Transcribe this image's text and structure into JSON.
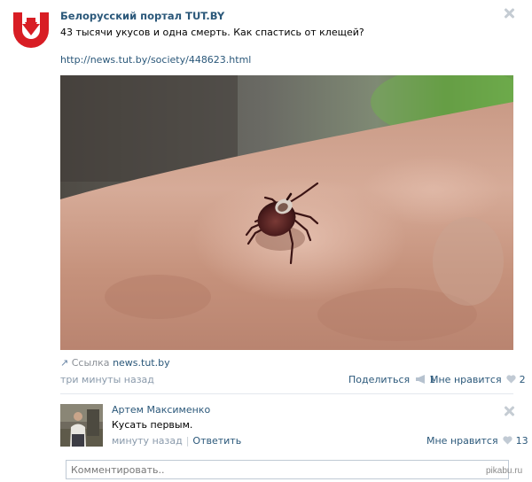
{
  "post": {
    "author": "Белорусский портал TUT.BY",
    "text": "43 тысячи укусов и одна смерть. Как спастись от клещей?",
    "url": "http://news.tut.by/society/448623.html",
    "photo_icon": "tick-on-skin-photo",
    "link_label": "Ссылка",
    "link_source": "news.tut.by",
    "time": "три минуты назад",
    "share_label": "Поделиться",
    "share_count": "1",
    "like_label": "Мне нравится",
    "like_count": "2"
  },
  "comment": {
    "author": "Артем Максименко",
    "text": "Кусать первым.",
    "time": "минуту назад",
    "reply_label": "Ответить",
    "like_label": "Мне нравится",
    "like_count": "13"
  },
  "composer": {
    "placeholder": "Комментировать.."
  },
  "watermark": "pikabu.ru",
  "colors": {
    "link": "#2b587a",
    "muted": "#8a9aab",
    "logo_red": "#d81d24"
  }
}
